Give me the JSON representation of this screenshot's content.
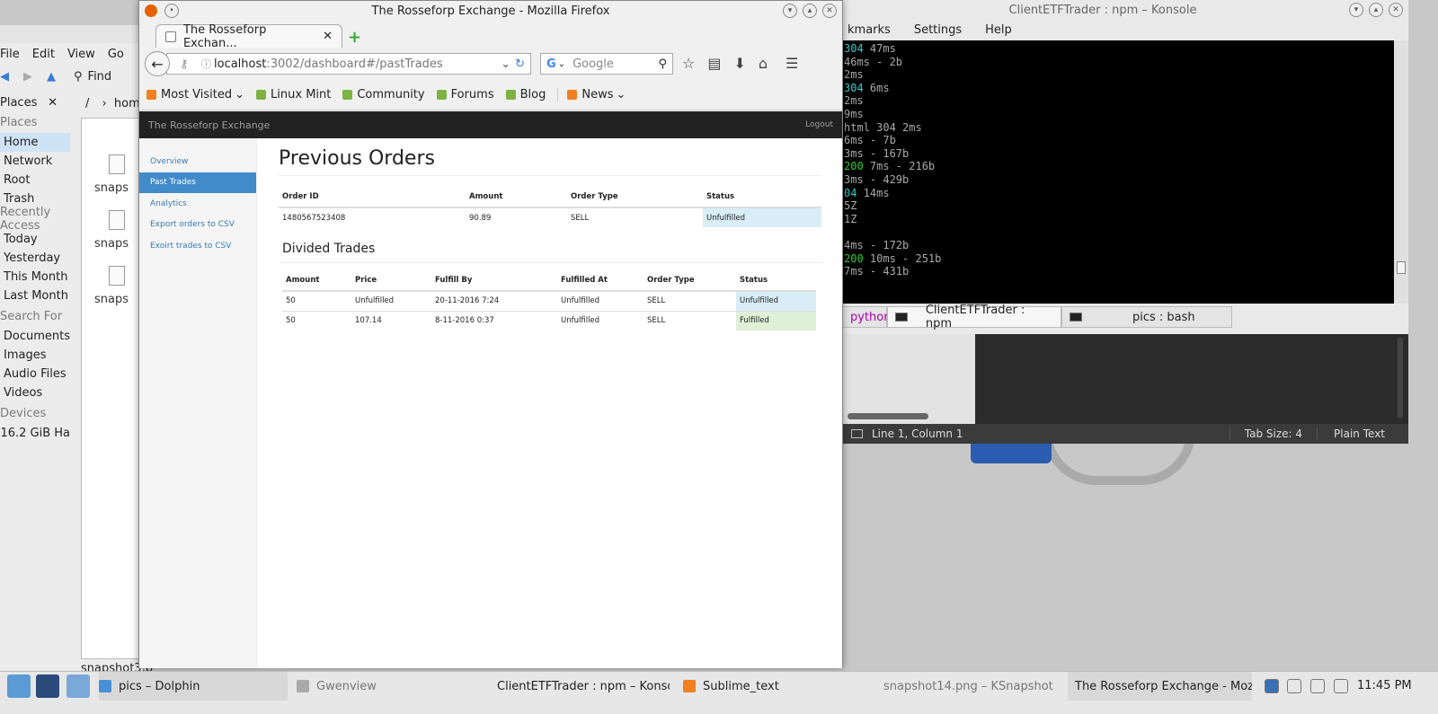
{
  "firefox": {
    "window_title": "The Rosseforp Exchange - Mozilla Firefox",
    "tab_title": "The Rosseforp Exchan...",
    "url_host": "localhost",
    "url_path": ":3002/dashboard#/pastTrades",
    "search_placeholder": "Google",
    "bookmarks": [
      {
        "label": "Most Visited",
        "icon": "folder-icon"
      },
      {
        "label": "Linux Mint",
        "icon": "mint-icon"
      },
      {
        "label": "Community",
        "icon": "mint-icon"
      },
      {
        "label": "Forums",
        "icon": "mint-icon"
      },
      {
        "label": "Blog",
        "icon": "mint-icon"
      },
      {
        "label": "News",
        "icon": "rss-icon"
      }
    ]
  },
  "app": {
    "brand": "The Rosseforp Exchange",
    "logout": "Logout",
    "sidebar": [
      {
        "label": "Overview",
        "active": false
      },
      {
        "label": "Past Trades",
        "active": true
      },
      {
        "label": "Analytics",
        "active": false
      },
      {
        "label": "Export orders to CSV",
        "active": false
      },
      {
        "label": "Exoirt trades to CSV",
        "active": false
      }
    ],
    "page_title": "Previous Orders",
    "orders": {
      "headers": [
        "Order ID",
        "Amount",
        "Order Type",
        "Status"
      ],
      "rows": [
        {
          "order_id": "1480567523408",
          "amount": "90.89",
          "order_type": "SELL",
          "status": "Unfulfilled"
        }
      ]
    },
    "divided_title": "Divided Trades",
    "trades": {
      "headers": [
        "Amount",
        "Price",
        "Fulfill By",
        "Fulfilled At",
        "Order Type",
        "Status"
      ],
      "rows": [
        {
          "amount": "50",
          "price": "Unfulfilled",
          "fulfill_by": "20-11-2016 7:24",
          "fulfilled_at": "Unfulfilled",
          "order_type": "SELL",
          "status": "Unfulfilled"
        },
        {
          "amount": "50",
          "price": "107.14",
          "fulfill_by": "8-11-2016 0:37",
          "fulfilled_at": "Unfulfilled",
          "order_type": "SELL",
          "status": "Fulfilled"
        }
      ]
    }
  },
  "dolphin": {
    "menu": [
      "File",
      "Edit",
      "View",
      "Go"
    ],
    "find": "Find",
    "places_header": "Places",
    "breadcrumb_root": "/",
    "breadcrumb_home": "hom",
    "sections": {
      "places": "Places",
      "recent": "Recently Access",
      "search": "Search For",
      "devices": "Devices"
    },
    "places": [
      "Home",
      "Network",
      "Root",
      "Trash"
    ],
    "recent": [
      "Today",
      "Yesterday",
      "This Month",
      "Last Month"
    ],
    "search": [
      "Documents",
      "Images",
      "Audio Files",
      "Videos"
    ],
    "devices": [
      "16.2 GiB Ha"
    ],
    "files": [
      "snaps",
      "snaps",
      "snaps"
    ],
    "status": "snapshot3.p"
  },
  "konsole": {
    "window_title": "ClientETFTrader : npm – Konsole",
    "menu": [
      "kmarks",
      "Settings",
      "Help"
    ],
    "lines": [
      {
        "a": "304",
        "ac": "#3cc",
        "b": " 47ms"
      },
      {
        "a": "",
        "ac": "",
        "b": "46ms - 2b"
      },
      {
        "a": "",
        "ac": "",
        "b": "2ms"
      },
      {
        "a": "304",
        "ac": "#3cc",
        "b": " 6ms"
      },
      {
        "a": "",
        "ac": "",
        "b": "2ms"
      },
      {
        "a": "",
        "ac": "",
        "b": "9ms"
      },
      {
        "a": "html ",
        "ac": "#aaa",
        "b": "304 2ms"
      },
      {
        "a": "",
        "ac": "",
        "b": "6ms - 7b"
      },
      {
        "a": "",
        "ac": "",
        "b": "3ms - 167b"
      },
      {
        "a": "200",
        "ac": "#3c3",
        "b": " 7ms - 216b"
      },
      {
        "a": "",
        "ac": "",
        "b": "3ms - 429b"
      },
      {
        "a": "04",
        "ac": "#3cc",
        "b": " 14ms"
      },
      {
        "a": "",
        "ac": "",
        "b": "5Z"
      },
      {
        "a": "",
        "ac": "",
        "b": "1Z"
      },
      {
        "a": "",
        "ac": "",
        "b": " "
      },
      {
        "a": "",
        "ac": "",
        "b": "4ms - 172b"
      },
      {
        "a": "200",
        "ac": "#3c3",
        "b": " 10ms - 251b"
      },
      {
        "a": "",
        "ac": "",
        "b": "7ms - 431b"
      }
    ],
    "tabs": [
      "python",
      "ClientETFTrader : npm",
      "pics : bash"
    ]
  },
  "sublime": {
    "position": "Line 1, Column 1",
    "tab_size": "Tab Size: 4",
    "syntax": "Plain Text"
  },
  "taskbar": {
    "tasks": [
      "pics – Dolphin",
      "Gwenview",
      "ClientETFTrader : npm – Konsol",
      "Sublime_text",
      "snapshot14.png – KSnapshot",
      "The Rosseforp Exchange - Mozi"
    ],
    "clock": "11:45 PM"
  },
  "colors": {
    "accent": "#428bca",
    "info": "#d9edf7",
    "success": "#dff0d8",
    "navbar": "#222222"
  }
}
